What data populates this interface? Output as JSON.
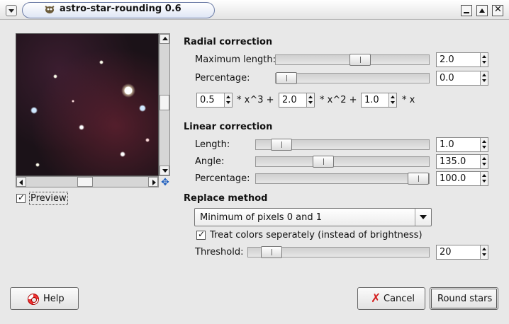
{
  "window": {
    "title": "astro-star-rounding 0.6"
  },
  "preview": {
    "checkbox_label": "Preview",
    "checked": true
  },
  "radial": {
    "title": "Radial correction",
    "max_length": {
      "label": "Maximum length:",
      "value": "2.0",
      "fraction": 0.56
    },
    "percentage": {
      "label": "Percentage:",
      "value": "0.0",
      "fraction": 0.0
    },
    "poly": {
      "c3": "0.5",
      "t3": "* x^3 +",
      "c2": "2.0",
      "t2": "* x^2 +",
      "c1": "1.0",
      "t1": "* x"
    }
  },
  "linear": {
    "title": "Linear correction",
    "length": {
      "label": "Length:",
      "value": "1.0",
      "fraction": 0.1
    },
    "angle": {
      "label": "Angle:",
      "value": "135.0",
      "fraction": 0.375
    },
    "percentage": {
      "label": "Percentage:",
      "value": "100.0",
      "fraction": 1.0
    }
  },
  "replace": {
    "title": "Replace method",
    "method_selected": "Minimum of pixels 0 and 1",
    "treat_colors_label": "Treat colors seperately (instead of brightness)",
    "treat_colors_checked": true,
    "threshold": {
      "label": "Threshold:",
      "value": "20",
      "fraction": 0.08
    }
  },
  "buttons": {
    "help": "Help",
    "cancel": "Cancel",
    "round": "Round stars"
  },
  "icons": {
    "window_menu": "window-menu-icon",
    "minimize": "minimize-icon",
    "maximize": "maximize-icon",
    "close": "close-icon",
    "navigate": "navigate-icon",
    "help": "help-lifebuoy-icon",
    "cancel": "cancel-x-icon"
  }
}
